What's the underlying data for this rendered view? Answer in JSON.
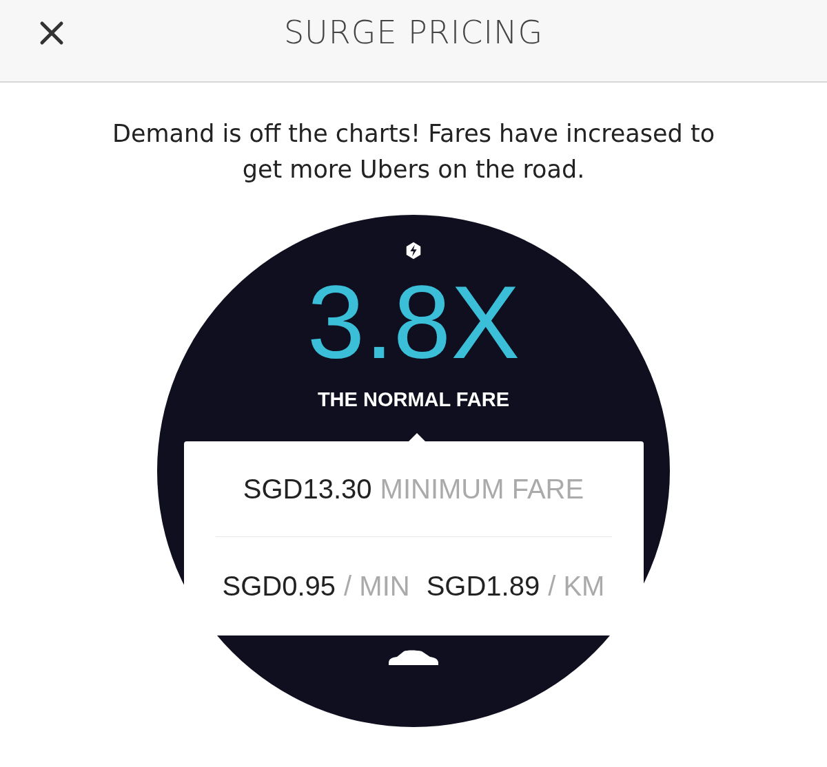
{
  "header": {
    "title": "SURGE PRICING"
  },
  "message": "Demand is off the charts! Fares have increased to get more Ubers on the road.",
  "surge": {
    "multiplier": "3.8X",
    "caption": "THE NORMAL FARE"
  },
  "minimum_fare": {
    "amount": "SGD13.30",
    "label": "MINIMUM FARE"
  },
  "rates": [
    {
      "amount": "SGD0.95",
      "unit": "/ MIN"
    },
    {
      "amount": "SGD1.89",
      "unit": "/ KM"
    }
  ]
}
